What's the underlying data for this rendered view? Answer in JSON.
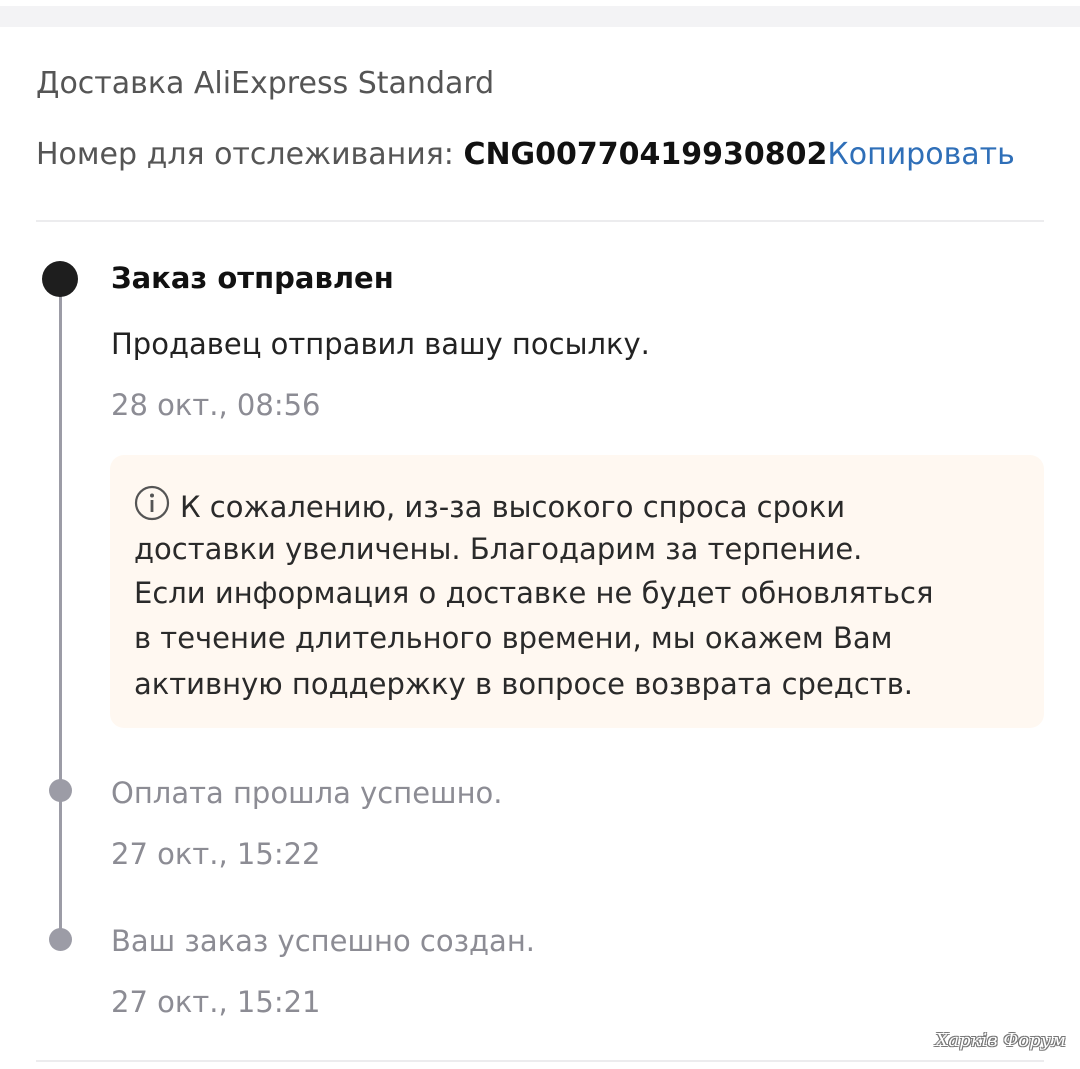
{
  "shipping": {
    "method": "Доставка AliExpress Standard",
    "tracking_label": "Номер для отслеживания: ",
    "tracking_number": "CNG00770419930802",
    "copy_label": "Копировать"
  },
  "events": [
    {
      "title": "Заказ отправлен",
      "description": "Продавец отправил вашу посылку.",
      "time": "28 окт., 08:56"
    },
    {
      "description": "Оплата прошла успешно.",
      "time": "27 окт., 15:22"
    },
    {
      "description": "Ваш заказ успешно создан.",
      "time": "27 окт., 15:21"
    }
  ],
  "notice": {
    "icon": "info-icon",
    "lines": [
      "К сожалению, из-за высокого спроса сроки",
      "доставки увеличены. Благодарим за терпение.",
      "Если информация о доставке не будет обновляться",
      "в течение длительного времени, мы окажем Вам",
      "активную поддержку в вопросе возврата средств."
    ]
  },
  "watermark": "Харків Форум",
  "colors": {
    "link": "#2f6fb8",
    "active_dot": "#1e1e1e",
    "inactive_dot": "#9c9ca6",
    "notice_bg": "#fff8f1"
  }
}
